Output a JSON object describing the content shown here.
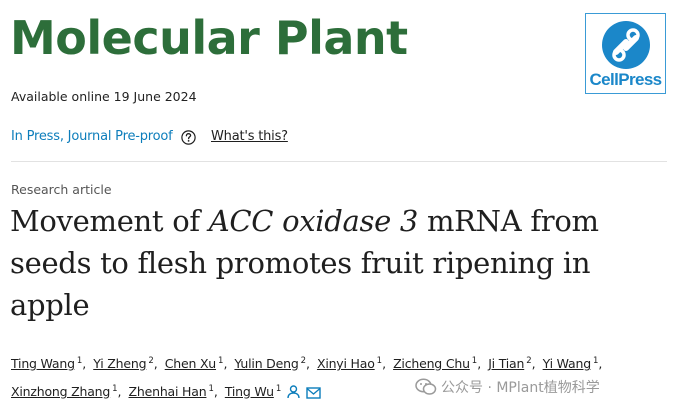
{
  "header": {
    "journal_title": "Molecular Plant",
    "logo_text": "CellPress",
    "available_online": "Available online 19 June 2024"
  },
  "status": {
    "in_press": "In Press, Journal Pre-proof",
    "whats_this": "What's this?"
  },
  "article": {
    "type": "Research article",
    "title_part1": "Movement of ",
    "title_italic": "ACC oxidase 3",
    "title_part2": " mRNA from seeds to flesh promotes fruit ripening in apple"
  },
  "authors": {
    "line1": [
      {
        "name": "Ting Wang",
        "sup": "1"
      },
      {
        "name": "Yi Zheng",
        "sup": "2"
      },
      {
        "name": "Chen Xu",
        "sup": "1"
      },
      {
        "name": "Yulin Deng",
        "sup": "2"
      },
      {
        "name": "Xinyi Hao",
        "sup": "1"
      },
      {
        "name": "Zicheng Chu",
        "sup": "1"
      },
      {
        "name": "Ji Tian",
        "sup": "2"
      },
      {
        "name": "Yi Wang",
        "sup": "1"
      }
    ],
    "line2": [
      {
        "name": "Xinzhong Zhang",
        "sup": "1"
      },
      {
        "name": "Zhenhai Han",
        "sup": "1"
      },
      {
        "name": "Ting Wu",
        "sup": "1"
      }
    ],
    "separator": ",",
    "icons": [
      "person-icon",
      "envelope-icon"
    ]
  },
  "watermark": {
    "text": "公众号 · MPlant植物科学",
    "icon": "wechat-icon"
  },
  "colors": {
    "journal_green": "#2d6e3a",
    "link_blue": "#0c7dbb",
    "cellpress_blue": "#1b87c9"
  }
}
